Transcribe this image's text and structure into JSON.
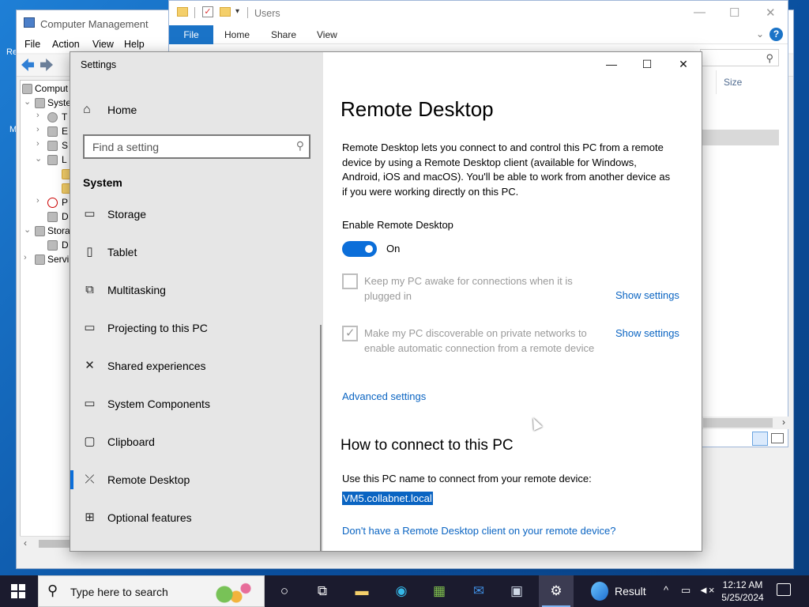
{
  "desktop": {
    "icon_letters": [
      "Re",
      "M"
    ]
  },
  "computer_management": {
    "title": "Computer Management",
    "menu": [
      "File",
      "Action",
      "View",
      "Help"
    ],
    "tree": [
      {
        "label": "Comput"
      },
      {
        "label": "Syste"
      },
      {
        "label": "T"
      },
      {
        "label": "E"
      },
      {
        "label": "S"
      },
      {
        "label": "L"
      },
      {
        "label": ""
      },
      {
        "label": ""
      },
      {
        "label": "P"
      },
      {
        "label": "D"
      },
      {
        "label": "Stora"
      },
      {
        "label": "D"
      },
      {
        "label": "Servi"
      }
    ]
  },
  "explorer": {
    "title": "Users",
    "ribbon_tabs": [
      "File",
      "Home",
      "Share",
      "View"
    ],
    "column_size": "Size"
  },
  "settings": {
    "window_title": "Settings",
    "home_label": "Home",
    "search_placeholder": "Find a setting",
    "section": "System",
    "nav": [
      {
        "label": "Storage",
        "icon": "storage-icon"
      },
      {
        "label": "Tablet",
        "icon": "tablet-icon"
      },
      {
        "label": "Multitasking",
        "icon": "multitasking-icon"
      },
      {
        "label": "Projecting to this PC",
        "icon": "projecting-icon"
      },
      {
        "label": "Shared experiences",
        "icon": "shared-experiences-icon"
      },
      {
        "label": "System Components",
        "icon": "system-components-icon"
      },
      {
        "label": "Clipboard",
        "icon": "clipboard-icon"
      },
      {
        "label": "Remote Desktop",
        "icon": "remote-desktop-icon",
        "active": true
      },
      {
        "label": "Optional features",
        "icon": "optional-features-icon"
      }
    ],
    "page_title": "Remote Desktop",
    "description": "Remote Desktop lets you connect to and control this PC from a remote device by using a Remote Desktop client (available for Windows, Android, iOS and macOS). You'll be able to work from another device as if you were working directly on this PC.",
    "enable_label": "Enable Remote Desktop",
    "toggle_state": "On",
    "option1": "Keep my PC awake for connections when it is plugged in",
    "option2": "Make my PC discoverable on private networks to enable automatic connection from a remote device",
    "show_settings": "Show settings",
    "advanced_settings": "Advanced settings",
    "connect_heading": "How to connect to this PC",
    "use_name_text": "Use this PC name to connect from your remote device:",
    "pc_name": "VM5.collabnet.local",
    "no_client_link": "Don't have a Remote Desktop client on your remote device?"
  },
  "taskbar": {
    "search_placeholder": "Type here to search",
    "result_label": "Result",
    "time": "12:12 AM",
    "date": "5/25/2024"
  },
  "colors": {
    "accent": "#0b6ed9",
    "link": "#0a64c2",
    "taskbar": "#1b1b2e"
  }
}
